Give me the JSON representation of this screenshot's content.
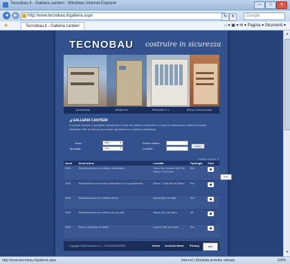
{
  "browser": {
    "window_title": "Tecnobau.it - Galleria cantieri - Windows Internet Explorer",
    "window_buttons": [
      "—",
      "□",
      "✕"
    ],
    "url": "http://www.tecnobau.it/galleria.aspx",
    "search_placeholder": "Google",
    "tab_label": "Tecnobau.it - Galleria cantieri",
    "tools_text": "⌂ ▾  ▣ ▾  ✉ ▾  Pagina ▾  Strumenti ▾",
    "nav": {
      "back": "◄",
      "forward": "►",
      "refresh": "↻",
      "stop": "✕"
    }
  },
  "site": {
    "logo": "TECNOBAU",
    "tagline": "costruire in sicurezza",
    "menu": [
      "AZIENDA",
      "SERVIZI",
      "PROGETTI",
      "REALIZZAZIONI"
    ],
    "section_title": "GALLERIA CANTIERI",
    "intro": "In questa sezione è possibile visualizzare le foto dei cantieri realizzati e in corso di realizzazione dalla Tecnobau. Utilizzare i filtri di ricerca per trovare rapidamente il cantiere desiderato.",
    "filters": {
      "anno_label": "Anno:",
      "anno_value": "2008",
      "tipologia_label": "Tipologia:",
      "tipologia_value": "Tutte",
      "parola_label": "Parola chiave:",
      "localita_label": "Località:",
      "search_button": "Cerca"
    },
    "results_count": "Cantieri trovati: 5",
    "table": {
      "headers": [
        "Anno",
        "Descrizione",
        "Località",
        "Tipologia",
        "Foto"
      ],
      "rows": [
        {
          "anno": "2008",
          "descrizione": "Ristrutturazione di un edificio residenziale",
          "localita": "Sesto San Giovanni (MI) Via Milano / Via Roma",
          "tipologia": "Res"
        },
        {
          "anno": "2008",
          "descrizione": "Realizzazione di una casa unifamiliare con 4 appartamenti",
          "localita": "Milano - Viale Monza Milano",
          "tipologia": "Res"
        },
        {
          "anno": "2008",
          "descrizione": "Ristrutturazione di un edificio storico",
          "localita": "Monza (MI) Via Italia",
          "tipologia": "Res"
        },
        {
          "anno": "2008",
          "descrizione": "Ristrutturazione di un edificio ad uso uffici",
          "localita": "Milano (MI) Via Torino",
          "tipologia": "Uff"
        },
        {
          "anno": "2008",
          "descrizione": "Nuovo complesso di villette",
          "localita": "Lissone (MI) Via Dante",
          "tipologia": "Res"
        }
      ]
    },
    "tooltip": "Foto",
    "footer": {
      "copyright": "Copyright 2008 Tecnobau s.r.l. - P.IVA 00000000000",
      "links": [
        "Home",
        "Archivio News",
        "Privacy"
      ],
      "badge": "W3C"
    }
  },
  "status": {
    "url": "http://www.tecnobau.it/galleria.aspx",
    "zone": "Internet | Modalità protetta: attivata",
    "zoom": "100%"
  },
  "colors": {
    "page_bg": "#28437a",
    "content_bg": "#33518c",
    "accent": "#f2f5fb"
  }
}
